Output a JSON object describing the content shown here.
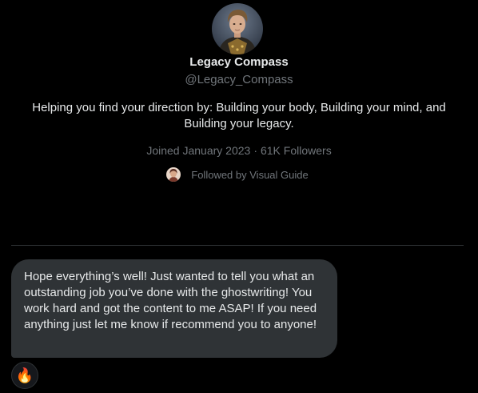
{
  "profile": {
    "display_name": "Legacy Compass",
    "handle": "@Legacy_Compass",
    "bio": "Helping you find your direction by: Building your body, Building your mind, and Building your legacy.",
    "joined": "Joined January 2023",
    "separator": "·",
    "followers": "61K Followers",
    "followed_by": "Followed by Visual Guide"
  },
  "message": {
    "text": "Hope everything’s well! Just wanted to tell you what an outstanding job you’ve done with the ghostwriting! You work hard and got the content to me ASAP! If you need anything just let me know if recommend you to anyone!"
  },
  "reaction": {
    "emoji": "🔥"
  },
  "colors": {
    "background": "#000000",
    "primary_text": "#e7e9ea",
    "secondary_text": "#71767b",
    "divider": "#2f3336",
    "bubble": "#2f3336"
  },
  "icons": {
    "profile_avatar": "profile-avatar-image",
    "follower_avatar": "follower-avatar-image"
  }
}
